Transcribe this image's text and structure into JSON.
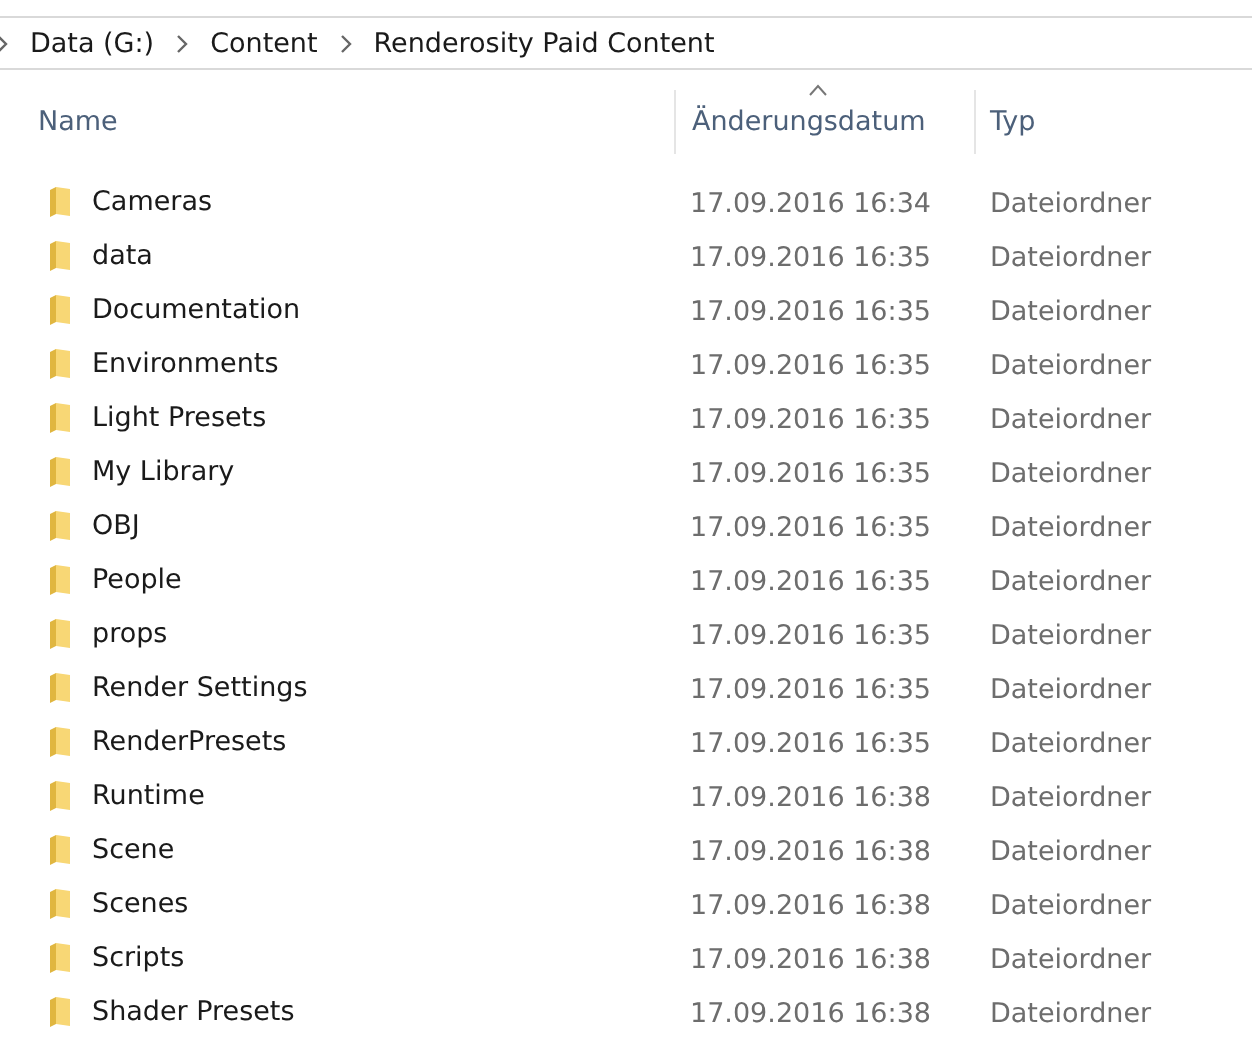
{
  "breadcrumb": [
    "Data (G:)",
    "Content",
    "Renderosity Paid Content"
  ],
  "columns": [
    {
      "label": "Name",
      "sorted": false
    },
    {
      "label": "Änderungsdatum",
      "sorted": true
    },
    {
      "label": "Typ",
      "sorted": false
    }
  ],
  "rows": [
    {
      "name": "Cameras",
      "date": "17.09.2016 16:34",
      "type": "Dateiordner"
    },
    {
      "name": "data",
      "date": "17.09.2016 16:35",
      "type": "Dateiordner"
    },
    {
      "name": "Documentation",
      "date": "17.09.2016 16:35",
      "type": "Dateiordner"
    },
    {
      "name": "Environments",
      "date": "17.09.2016 16:35",
      "type": "Dateiordner"
    },
    {
      "name": "Light Presets",
      "date": "17.09.2016 16:35",
      "type": "Dateiordner"
    },
    {
      "name": "My Library",
      "date": "17.09.2016 16:35",
      "type": "Dateiordner"
    },
    {
      "name": "OBJ",
      "date": "17.09.2016 16:35",
      "type": "Dateiordner"
    },
    {
      "name": "People",
      "date": "17.09.2016 16:35",
      "type": "Dateiordner"
    },
    {
      "name": "props",
      "date": "17.09.2016 16:35",
      "type": "Dateiordner"
    },
    {
      "name": "Render Settings",
      "date": "17.09.2016 16:35",
      "type": "Dateiordner"
    },
    {
      "name": "RenderPresets",
      "date": "17.09.2016 16:35",
      "type": "Dateiordner"
    },
    {
      "name": "Runtime",
      "date": "17.09.2016 16:38",
      "type": "Dateiordner"
    },
    {
      "name": "Scene",
      "date": "17.09.2016 16:38",
      "type": "Dateiordner"
    },
    {
      "name": "Scenes",
      "date": "17.09.2016 16:38",
      "type": "Dateiordner"
    },
    {
      "name": "Scripts",
      "date": "17.09.2016 16:38",
      "type": "Dateiordner"
    },
    {
      "name": "Shader Presets",
      "date": "17.09.2016 16:38",
      "type": "Dateiordner"
    }
  ]
}
